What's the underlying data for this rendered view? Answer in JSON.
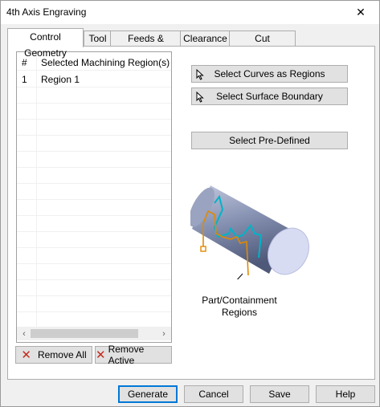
{
  "window": {
    "title": "4th Axis Engraving",
    "close_glyph": "✕"
  },
  "tabs": [
    {
      "label": "Control Geometry",
      "active": true
    },
    {
      "label": "Tool"
    },
    {
      "label": "Feeds & Speeds"
    },
    {
      "label": "Clearance"
    },
    {
      "label": "Cut Parameters"
    }
  ],
  "region_list": {
    "columns": [
      "#",
      "Selected Machining Region(s)"
    ],
    "rows": [
      {
        "num": "1",
        "name": "Region 1"
      }
    ],
    "scroll_left": "‹",
    "scroll_right": "›"
  },
  "select_buttons": {
    "curves": "Select Curves as Regions",
    "surface": "Select Surface Boundary",
    "predefined": "Select Pre-Defined"
  },
  "list_buttons": {
    "remove_all": "Remove All",
    "remove_active": "Remove Active"
  },
  "illustration": {
    "caption_line1": "Part/Containment",
    "caption_line2": "Regions",
    "colors": {
      "cylinder": "#8a95b5",
      "cap": "#d8dcf3",
      "region": "#00b4c8",
      "containment": "#e08a00"
    }
  },
  "footer": {
    "generate": "Generate",
    "cancel": "Cancel",
    "save": "Save",
    "help": "Help"
  }
}
